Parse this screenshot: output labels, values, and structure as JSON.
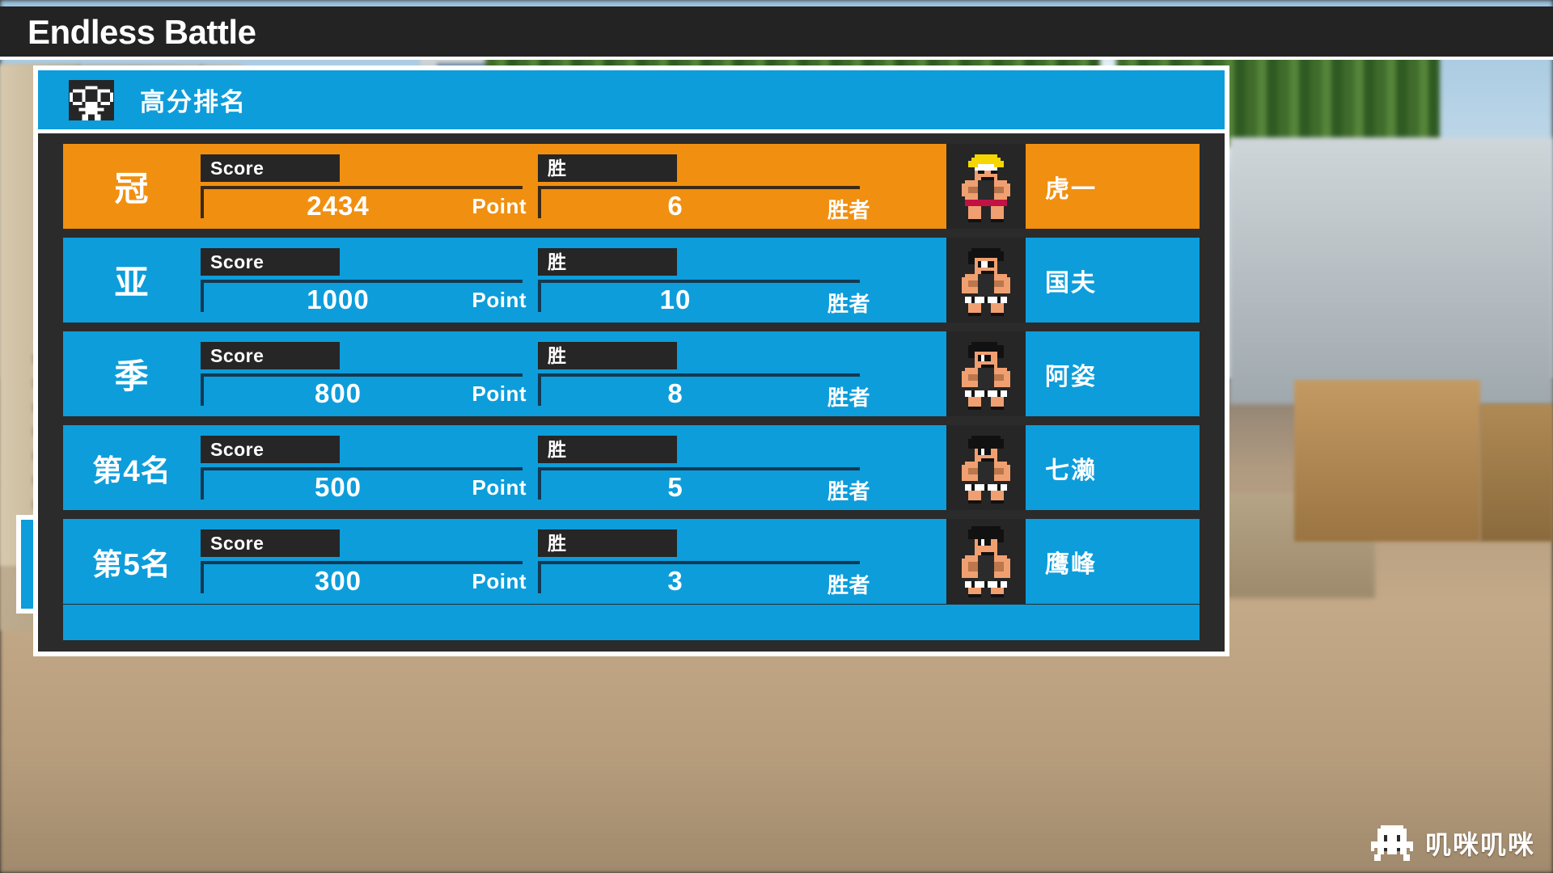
{
  "window": {
    "game_title": "Endless Battle"
  },
  "panel": {
    "header_title": "高分排名",
    "header_icon": "crowd-pixel-icon"
  },
  "columns": {
    "score_label": "Score",
    "score_unit": "Point",
    "wins_label": "胜",
    "wins_unit": "胜者"
  },
  "colors": {
    "accent_blue": "#0d9ddb",
    "accent_orange": "#f18f10",
    "panel_dark": "#2b2b2b",
    "label_dark": "#262626",
    "white": "#ffffff"
  },
  "rows": [
    {
      "rank": "冠",
      "score": "2434",
      "score_unit": "Point",
      "wins": "6",
      "wins_unit": "胜者",
      "name": "虎一",
      "score_label": "Score",
      "wins_label": "胜",
      "avatar": "fighter-blond-sprite",
      "highlight": true
    },
    {
      "rank": "亚",
      "score": "1000",
      "score_unit": "Point",
      "wins": "10",
      "wins_unit": "胜者",
      "name": "国夫",
      "score_label": "Score",
      "wins_label": "胜",
      "avatar": "fighter-kunio-sprite",
      "highlight": false
    },
    {
      "rank": "季",
      "score": "800",
      "score_unit": "Point",
      "wins": "8",
      "wins_unit": "胜者",
      "name": "阿姿",
      "score_label": "Score",
      "wins_label": "胜",
      "avatar": "fighter-spiky-sprite",
      "highlight": false
    },
    {
      "rank": "第4名",
      "score": "500",
      "score_unit": "Point",
      "wins": "5",
      "wins_unit": "胜者",
      "name": "七濑",
      "score_label": "Score",
      "wins_label": "胜",
      "avatar": "fighter-dark-sprite",
      "highlight": false
    },
    {
      "rank": "第5名",
      "score": "300",
      "score_unit": "Point",
      "wins": "3",
      "wins_unit": "胜者",
      "name": "鹰峰",
      "score_label": "Score",
      "wins_label": "胜",
      "avatar": "fighter-tall-sprite",
      "highlight": false
    }
  ],
  "watermark": {
    "text": "叽咪叽咪",
    "icon": "invader-pixel-icon"
  }
}
